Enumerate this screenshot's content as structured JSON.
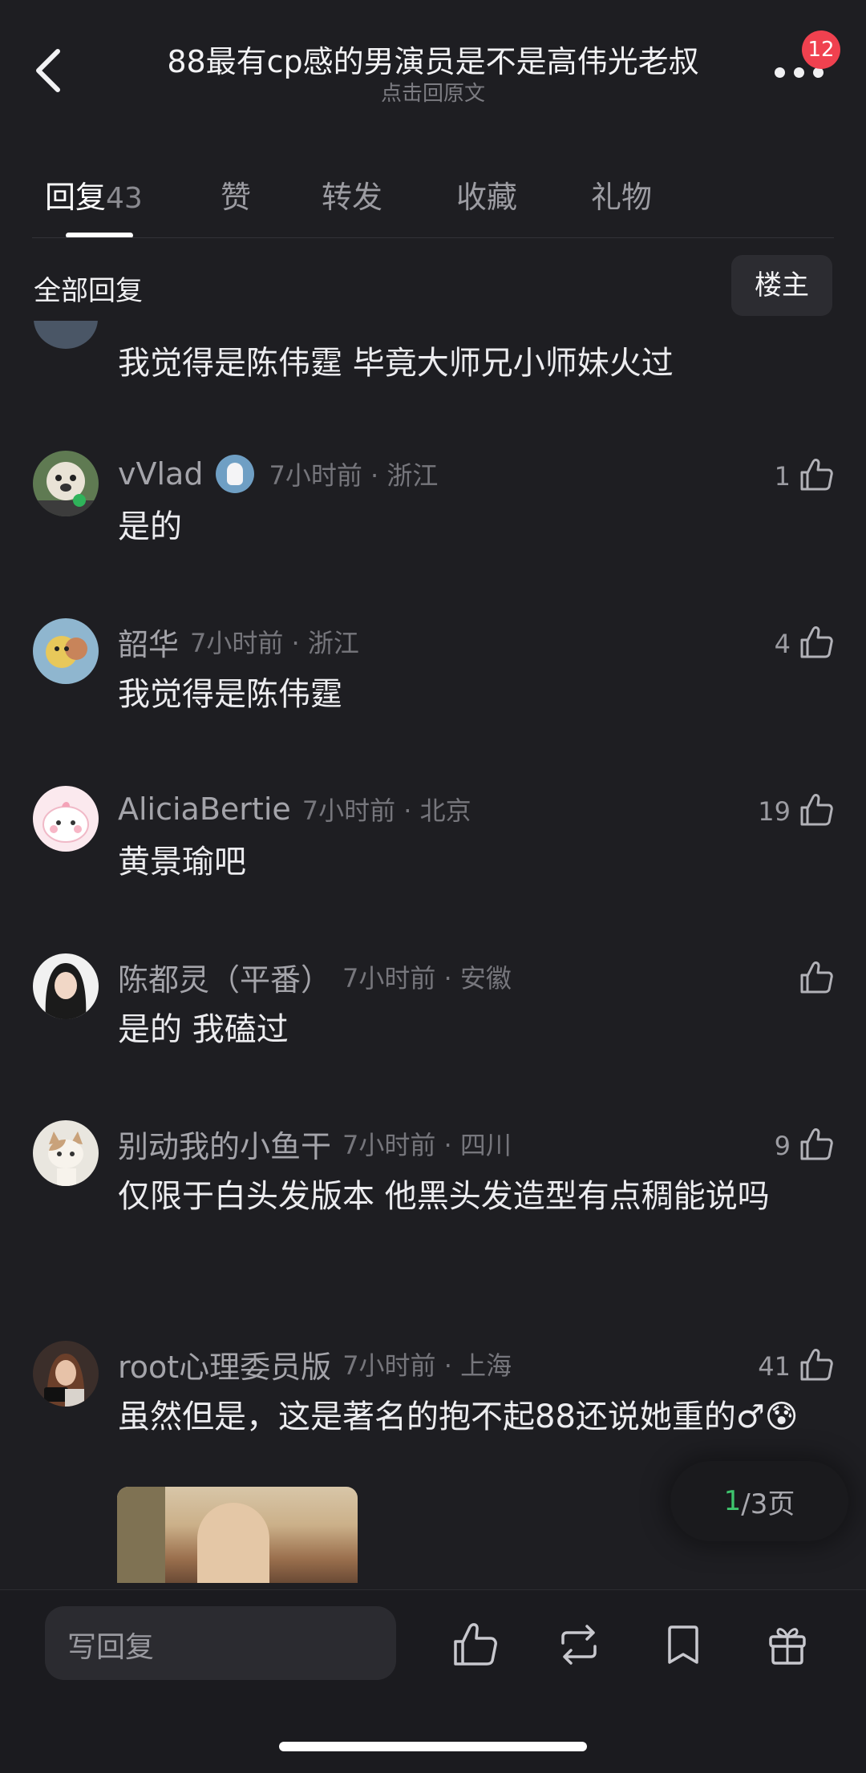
{
  "header": {
    "title": "88最有cp感的男演员是不是高伟光老叔",
    "subtitle": "点击回原文",
    "notification_count": "12"
  },
  "tabs": [
    {
      "label": "回复",
      "count": "43",
      "active": true
    },
    {
      "label": "赞"
    },
    {
      "label": "转发"
    },
    {
      "label": "收藏"
    },
    {
      "label": "礼物"
    }
  ],
  "section": {
    "title": "全部回复",
    "owner_button": "楼主"
  },
  "comments": [
    {
      "text": "我觉得是陈伟霆 毕竟大师兄小师妹火过"
    },
    {
      "name": "vVlad",
      "time": "7小时前 · 浙江",
      "likes": "1",
      "text": "是的",
      "badge_icon": "penguin-badge-icon"
    },
    {
      "name": "韶华",
      "time": "7小时前 · 浙江",
      "likes": "4",
      "text": "我觉得是陈伟霆"
    },
    {
      "name": "AliciaBertie",
      "time": "7小时前 · 北京",
      "likes": "19",
      "text": "黄景瑜吧"
    },
    {
      "name": "陈都灵（平番）",
      "time": "7小时前 · 安徽",
      "likes": "",
      "text": "是的 我磕过"
    },
    {
      "name": "别动我的小鱼干",
      "time": "7小时前 · 四川",
      "likes": "9",
      "text": "仅限于白头发版本  他黑头发造型有点稠能说吗"
    },
    {
      "name": "root心理委员版",
      "time": "7小时前 · 上海",
      "likes": "41",
      "text": "虽然但是，这是著名的抱不起88还说她重的♂😰"
    }
  ],
  "pager": {
    "current": "1",
    "rest": "/3页"
  },
  "bottom_bar": {
    "reply_placeholder": "写回复"
  },
  "colors": {
    "background": "#1e1e22",
    "badge": "#f0414f",
    "pager_current": "#3ec46d"
  }
}
